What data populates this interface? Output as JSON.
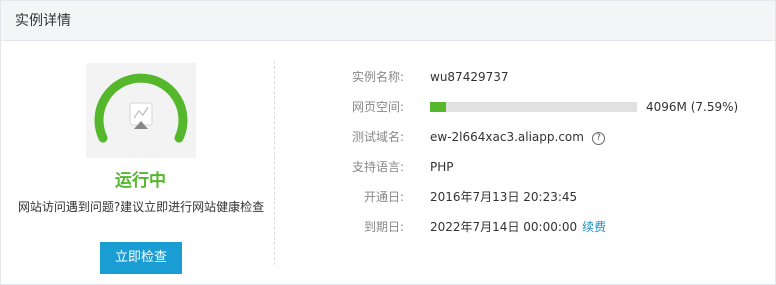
{
  "header": {
    "title": "实例详情"
  },
  "status": {
    "state_label": "运行中",
    "hint": "网站访问遇到问题?建议立即进行网站健康检查",
    "check_button": "立即检查",
    "colors": {
      "running": "#55b82c",
      "button": "#1a9dd3",
      "gauge_track": "#f3f3f3"
    }
  },
  "details": {
    "instance_name": {
      "label": "实例名称:",
      "value": "wu87429737"
    },
    "web_space": {
      "label": "网页空间:",
      "total": "4096M",
      "percent": "(7.59%)",
      "percent_value": 7.59
    },
    "test_domain": {
      "label": "测试域名:",
      "value": "ew-2l664xac3.aliapp.com",
      "help_icon": "?"
    },
    "language": {
      "label": "支持语言:",
      "value": "PHP"
    },
    "open_date": {
      "label": "开通日:",
      "value": "2016年7月13日 20:23:45"
    },
    "expire_date": {
      "label": "到期日:",
      "value": "2022年7月14日 00:00:00",
      "renew_link": "续费"
    }
  }
}
